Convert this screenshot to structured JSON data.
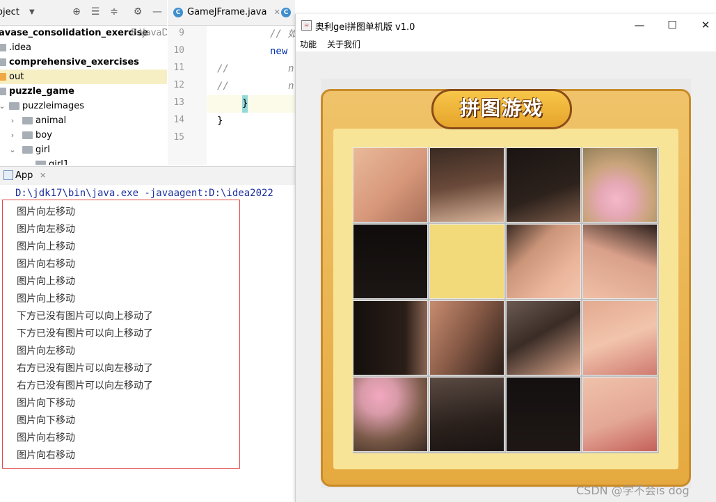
{
  "project_panel": {
    "header": "oject",
    "tree": [
      {
        "label": "avase_consolidation_exercise",
        "suffix": "E:\\JavaDe",
        "bold": true
      },
      {
        "label": ".idea"
      },
      {
        "label": "comprehensive_exercises",
        "bold": true
      },
      {
        "label": "out",
        "highlight": true
      },
      {
        "label": "puzzle_game",
        "bold": true
      },
      {
        "label": "puzzleimages"
      },
      {
        "label": "animal"
      },
      {
        "label": "boy"
      },
      {
        "label": "girl"
      },
      {
        "label": "girl1"
      }
    ]
  },
  "editor": {
    "tabs": [
      {
        "label": "GameJFrame.java"
      }
    ],
    "line_numbers": [
      "9",
      "10",
      "11",
      "12",
      "13",
      "14",
      "15"
    ],
    "code": {
      "l9": "// 如",
      "l10": "new",
      "l11_a": "//",
      "l11_b": "n",
      "l12_a": "//",
      "l12_b": "n",
      "l13": "}",
      "l14": "}"
    }
  },
  "run_panel": {
    "tab_label": "App",
    "command": "D:\\jdk17\\bin\\java.exe -javaagent:D:\\idea2022",
    "output": [
      "图片向左移动",
      "图片向左移动",
      "图片向上移动",
      "图片向右移动",
      "图片向上移动",
      "图片向上移动",
      "下方已没有图片可以向上移动了",
      "下方已没有图片可以向上移动了",
      "图片向左移动",
      "右方已没有图片可以向左移动了",
      "右方已没有图片可以向左移动了",
      "图片向下移动",
      "图片向下移动",
      "图片向右移动",
      "图片向右移动"
    ]
  },
  "game_window": {
    "title": "奥利gei拼图单机版 v1.0",
    "menu": [
      "功能",
      "关于我们"
    ],
    "banner": "拼图游戏",
    "controls": {
      "minimize": "—",
      "maximize": "☐",
      "close": "✕"
    }
  },
  "watermark": "CSDN @学不会is dog",
  "colors": {
    "annotation_box": "#e04848",
    "command_text": "#1b2f9f",
    "frame": "#e5a93f",
    "empty_tile": "#f2da7a"
  }
}
